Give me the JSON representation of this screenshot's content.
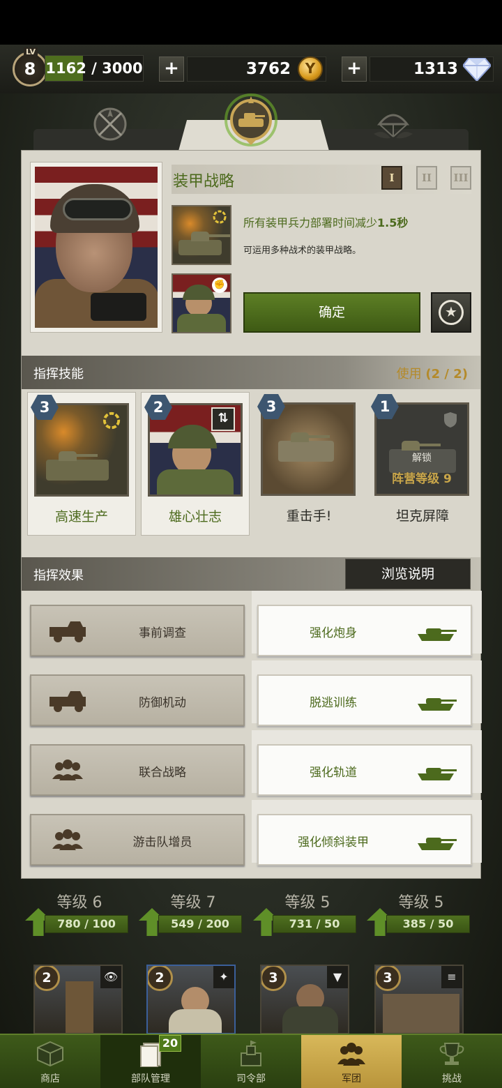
{
  "topbar": {
    "lv_label": "LV",
    "level": "8",
    "xp_text": "1162 / 3000",
    "xp_progress": 0.387,
    "plus": "+",
    "gold": "3762",
    "gold_glyph": "Y",
    "diamonds": "1313"
  },
  "doctrine": {
    "title": "装甲战略",
    "tiers": [
      "I",
      "II",
      "III"
    ],
    "selected_tier": "I",
    "effect_prefix": "所有装甲兵力部署时间减少",
    "effect_value": "1.5秒",
    "description": "可运用多种战术的装甲战略。",
    "swap_glyph": "⇅",
    "confirm_label": "确定",
    "star_glyph": "★"
  },
  "skills_section": {
    "header": "指挥技能",
    "usage_label": "使用",
    "usage_value": "(2 / 2)"
  },
  "skills": [
    {
      "level": "3",
      "name": "高速生产",
      "selected": true
    },
    {
      "level": "2",
      "name": "雄心壮志",
      "selected": true
    },
    {
      "level": "3",
      "name": "重击手!",
      "selected": false
    },
    {
      "level": "1",
      "name": "坦克屏障",
      "selected": false,
      "locked": true,
      "lock_title": "解锁",
      "lock_req": "阵营等级 9"
    }
  ],
  "effects_section": {
    "header": "指挥效果",
    "browse_label": "浏览说明"
  },
  "effects": [
    {
      "left": "事前调查",
      "left_icon": "jeep-icon",
      "right": "强化炮身"
    },
    {
      "left": "防御机动",
      "left_icon": "jeep-icon",
      "right": "脱逃训练"
    },
    {
      "left": "联合战略",
      "left_icon": "squad-icon",
      "right": "强化轨道"
    },
    {
      "left": "游击队增员",
      "left_icon": "squad-icon",
      "right": "强化倾斜装甲"
    }
  ],
  "background_cards": [
    {
      "level": "等级 6",
      "progress": "780 / 100"
    },
    {
      "level": "等级 7",
      "progress": "549 / 200"
    },
    {
      "level": "等级 5",
      "progress": "731 / 50"
    },
    {
      "level": "等级 5",
      "progress": "385 / 50"
    }
  ],
  "background_units": [
    {
      "rank": "2",
      "tag": "👁"
    },
    {
      "rank": "2",
      "tag": "✦"
    },
    {
      "rank": "3",
      "tag": "▼"
    },
    {
      "rank": "3",
      "tag": "≡"
    }
  ],
  "nav": {
    "items": [
      {
        "label": "商店",
        "icon": "shop-crate-icon"
      },
      {
        "label": "部队管理",
        "icon": "cards-icon",
        "badge": "20"
      },
      {
        "label": "司令部",
        "icon": "hq-building-icon"
      },
      {
        "label": "军团",
        "icon": "legion-icon"
      },
      {
        "label": "挑战",
        "icon": "trophy-icon"
      }
    ],
    "active": "军团"
  },
  "colors": {
    "accent_green": "#4c6a1d",
    "gold_text": "#b48a2a",
    "panel_bg": "#d9d6cb"
  }
}
